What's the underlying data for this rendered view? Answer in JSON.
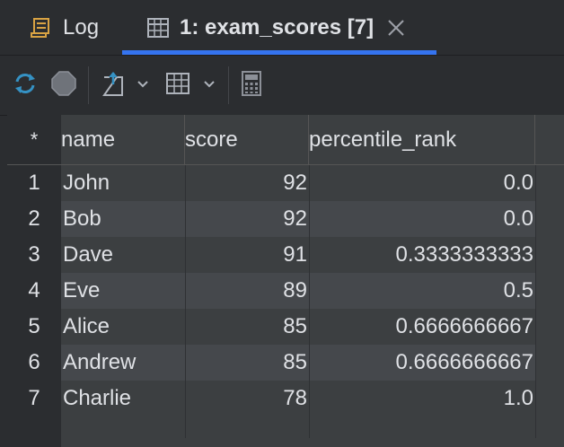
{
  "tabs": {
    "log_label": "Log",
    "active_label": "1: exam_scores [7]"
  },
  "toolbar": {
    "refresh": "refresh-icon",
    "stop": "stop-icon",
    "export": "export-icon",
    "view": "table-view-icon",
    "calculator": "calculator-icon"
  },
  "grid": {
    "corner": "*",
    "columns": [
      "name",
      "score",
      "percentile_rank"
    ],
    "rows": [
      {
        "num": "1",
        "name": "John",
        "score": "92",
        "pct": "0.0"
      },
      {
        "num": "2",
        "name": "Bob",
        "score": "92",
        "pct": "0.0"
      },
      {
        "num": "3",
        "name": "Dave",
        "score": "91",
        "pct": "0.3333333333"
      },
      {
        "num": "4",
        "name": "Eve",
        "score": "89",
        "pct": "0.5"
      },
      {
        "num": "5",
        "name": "Alice",
        "score": "85",
        "pct": "0.6666666667"
      },
      {
        "num": "6",
        "name": "Andrew",
        "score": "85",
        "pct": "0.6666666667"
      },
      {
        "num": "7",
        "name": "Charlie",
        "score": "78",
        "pct": "1.0"
      }
    ]
  },
  "colors": {
    "accent": "#3574f0",
    "background": "#2b2d30",
    "refresh_blue": "#3592c4"
  }
}
